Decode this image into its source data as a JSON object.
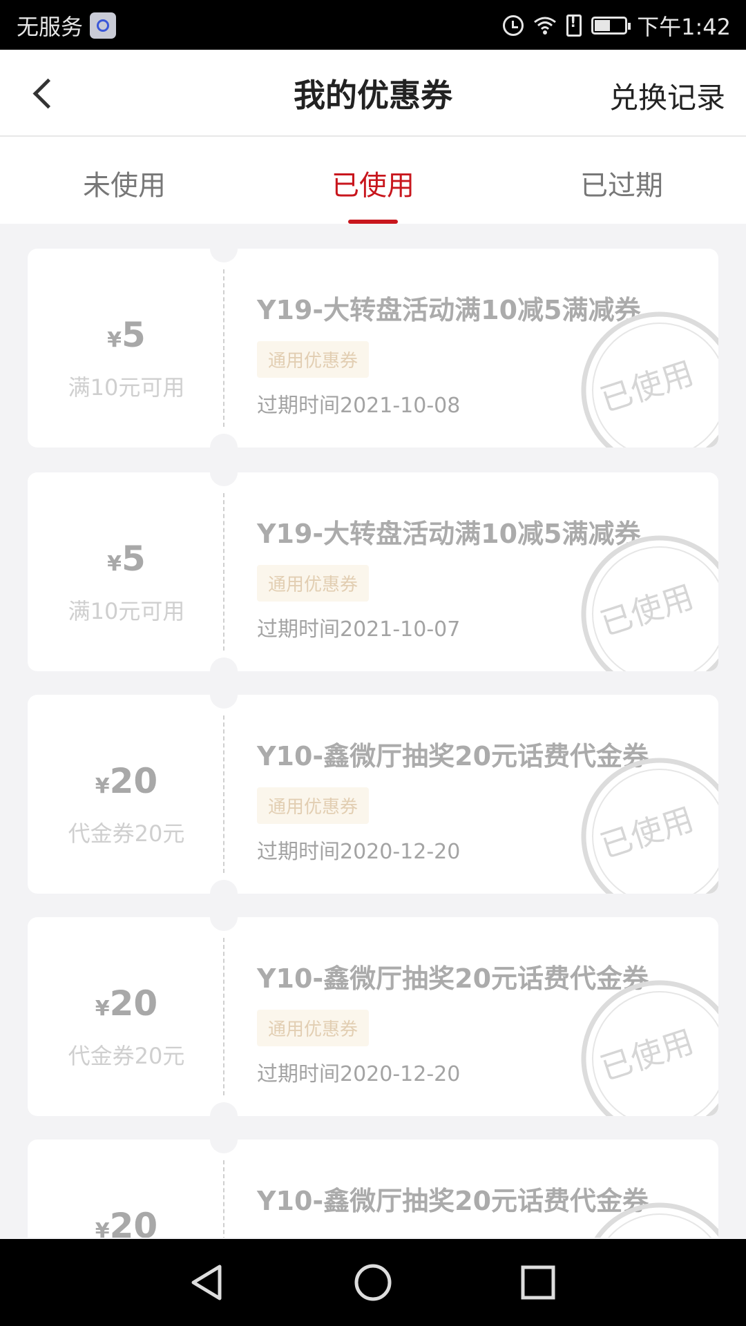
{
  "status_bar": {
    "carrier": "无服务",
    "time": "下午1:42"
  },
  "header": {
    "title": "我的优惠券",
    "right_link": "兑换记录"
  },
  "tabs": [
    {
      "label": "未使用"
    },
    {
      "label": "已使用",
      "active": true
    },
    {
      "label": "已过期"
    }
  ],
  "coupons": [
    {
      "currency": "¥",
      "amount": "5",
      "condition": "满10元可用",
      "title": "Y19-大转盘活动满10减5满减券",
      "tag": "通用优惠券",
      "expiry": "过期时间2021-10-08",
      "stamp": "已使用"
    },
    {
      "currency": "¥",
      "amount": "5",
      "condition": "满10元可用",
      "title": "Y19-大转盘活动满10减5满减券",
      "tag": "通用优惠券",
      "expiry": "过期时间2021-10-07",
      "stamp": "已使用"
    },
    {
      "currency": "¥",
      "amount": "20",
      "condition": "代金券20元",
      "title": "Y10-鑫微厅抽奖20元话费代金券",
      "tag": "通用优惠券",
      "expiry": "过期时间2020-12-20",
      "stamp": "已使用"
    },
    {
      "currency": "¥",
      "amount": "20",
      "condition": "代金券20元",
      "title": "Y10-鑫微厅抽奖20元话费代金券",
      "tag": "通用优惠券",
      "expiry": "过期时间2020-12-20",
      "stamp": "已使用"
    },
    {
      "currency": "¥",
      "amount": "20",
      "title": "Y10-鑫微厅抽奖20元话费代金券"
    }
  ],
  "colors": {
    "accent": "#c8161d",
    "page_bg": "#f3f3f5"
  },
  "icons": [
    "back-icon",
    "alarm-icon",
    "wifi-icon",
    "sim-alert-icon",
    "battery-icon",
    "nav-back-icon",
    "nav-home-icon",
    "nav-recents-icon"
  ]
}
